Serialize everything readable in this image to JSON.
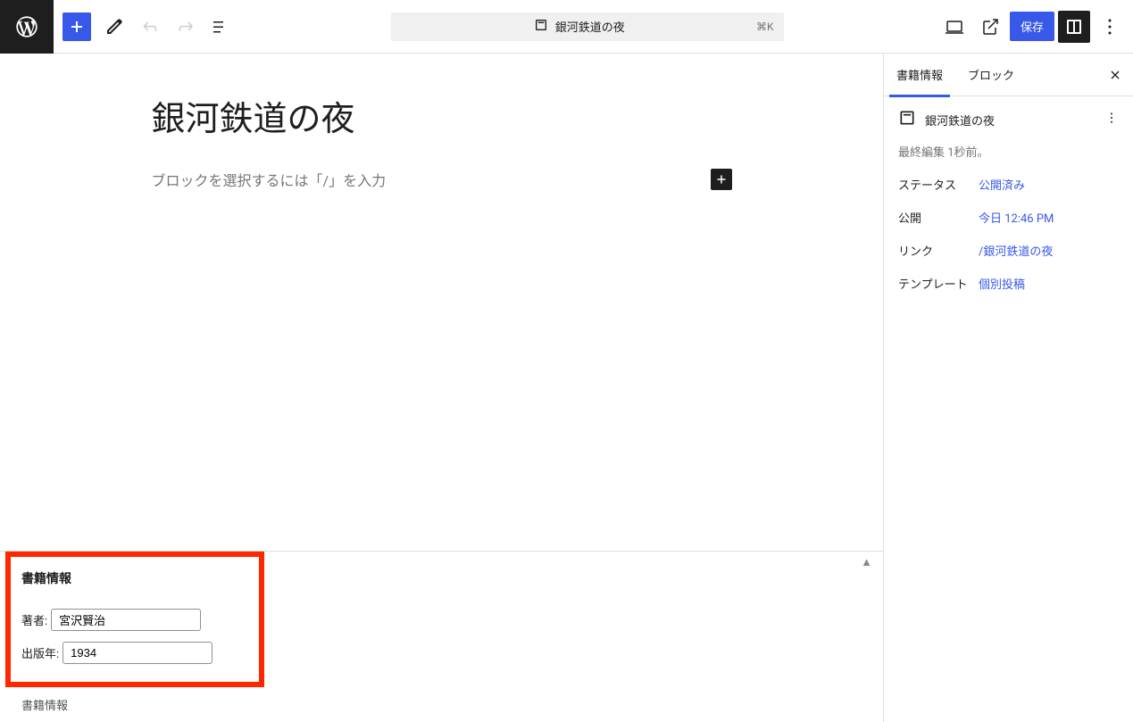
{
  "toolbar": {
    "doc_title": "銀河鉄道の夜",
    "shortcut": "⌘K",
    "save_label": "保存"
  },
  "editor": {
    "title": "銀河鉄道の夜",
    "placeholder": "ブロックを選択するには「/」を入力"
  },
  "metabox": {
    "title": "書籍情報",
    "author_label": "著者:",
    "author_value": "宮沢賢治",
    "year_label": "出版年:",
    "year_value": "1934",
    "footer": "書籍情報"
  },
  "sidebar": {
    "tabs": {
      "info": "書籍情報",
      "block": "ブロック"
    },
    "doc_title": "銀河鉄道の夜",
    "last_edit": "最終編集 1秒前。",
    "rows": {
      "status": {
        "label": "ステータス",
        "value": "公開済み"
      },
      "publish": {
        "label": "公開",
        "value": "今日 12:46 PM"
      },
      "link": {
        "label": "リンク",
        "value": "/銀河鉄道の夜"
      },
      "template": {
        "label": "テンプレート",
        "value": "個別投稿"
      }
    }
  }
}
